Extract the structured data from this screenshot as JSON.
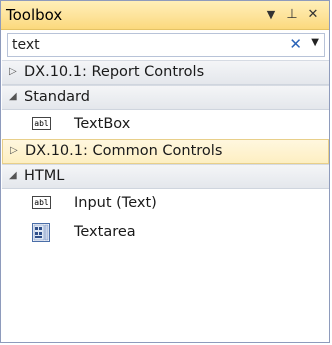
{
  "panel": {
    "title": "Toolbox",
    "dropdown_glyph": "▼",
    "pin_glyph": "⊥",
    "close_glyph": "✕"
  },
  "search": {
    "value": "text",
    "clear_glyph": "✕",
    "dropdown_glyph": "▼"
  },
  "groups": [
    {
      "label": "DX.10.1: Report Controls",
      "state": "collapsed",
      "arrow": "▷"
    },
    {
      "label": "Standard",
      "state": "expanded",
      "arrow": "◢"
    },
    {
      "label": "DX.10.1: Common Controls",
      "state": "collapsed",
      "arrow": "▷"
    },
    {
      "label": "HTML",
      "state": "expanded",
      "arrow": "◢"
    }
  ],
  "items": {
    "textbox": {
      "label": "TextBox",
      "icon_text": "abl",
      "icon": "textbox-icon"
    },
    "input_text": {
      "label": "Input (Text)",
      "icon_text": "abl",
      "icon": "textbox-icon"
    },
    "textarea": {
      "label": "Textarea",
      "icon": "textarea-icon"
    }
  },
  "colors": {
    "title_bar": "#fde39a",
    "highlight_row": "#fdefc2",
    "clear_button": "#2a63b8"
  }
}
